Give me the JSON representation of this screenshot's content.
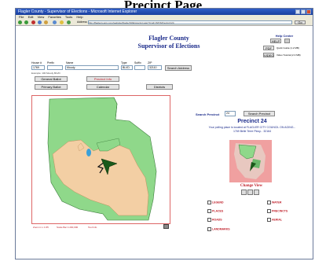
{
  "caption": "Precinct Page",
  "window": {
    "title": "Flagler County - Supervisor of Elections - Microsoft Internet Explorer",
    "menu": [
      "File",
      "Edit",
      "View",
      "Favorites",
      "Tools",
      "Help"
    ],
    "address_label": "Address",
    "address": "http://flaglercounty.com/website/FlaglerSOE/precinct.asp?Cmd=INIT&Precinct=24",
    "go_label": "Go"
  },
  "page": {
    "title_line1": "Flagler County",
    "title_line2": "Supervisor of Elections",
    "help": {
      "title": "Help Center",
      "help_btn": "HELP",
      "pdf_btn": "PDF",
      "pdf_text": "Quick Guide (1.2 MB)",
      "video_btn": "VIDEO",
      "video_text": "Video Tutorial (2.3 MB)"
    },
    "form": {
      "house_label": "House #",
      "prefix_label": "Prefix",
      "name_label": "Name",
      "type_label": "Type",
      "suffix_label": "Suffix",
      "zip_label": "ZIP",
      "house_value": "1769",
      "name_value": "Moody",
      "type_value": "BLVD",
      "zip_value": "32110",
      "search_address_btn": "Search Address",
      "example_text": "Example: 100   Moody   BLVD",
      "general_ballot_btn": "General Ballot",
      "precinct_info_btn": "Precinct Info",
      "primary_ballot_btn": "Primary Ballot",
      "calendar_btn": "Calendar",
      "districts_btn": "Districts"
    },
    "search_precinct_label": "Search Precinct",
    "search_precinct_value": "24",
    "search_precinct_btn": "Search Precinct",
    "precinct_title": "Precinct 24",
    "precinct_line1": "Your polling place is located at FLAGLER CITY COUNCIL ON AGING...",
    "precinct_line2": "1769 Belle Terre Pkwy... 32164",
    "change_view": "Change View",
    "layers": [
      "LEGEND",
      "PLACES",
      "ROADS",
      "LANDMARKS",
      "WATER",
      "PRECINCTS",
      "AERIAL"
    ],
    "map_footer": [
      "Zoom in x 1:65",
      "Scale Bar 1:200,000",
      "Tool Info"
    ]
  },
  "colors": {
    "land": "#8fd88a",
    "city": "#f3cfa4",
    "water": "#3aa0d8",
    "heading": "#1a2a8a",
    "accent": "#c0202a"
  }
}
